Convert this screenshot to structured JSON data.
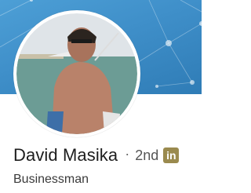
{
  "profile": {
    "name": "David Masika",
    "separator": "·",
    "connection_degree": "2nd",
    "network_badge": "in",
    "headline": "Businessman"
  },
  "icons": {
    "network_badge_icon": "linkedin-icon"
  },
  "colors": {
    "banner": "#3f8fc9",
    "badge": "#9a8a4e",
    "name_text": "#1d1d1d"
  }
}
